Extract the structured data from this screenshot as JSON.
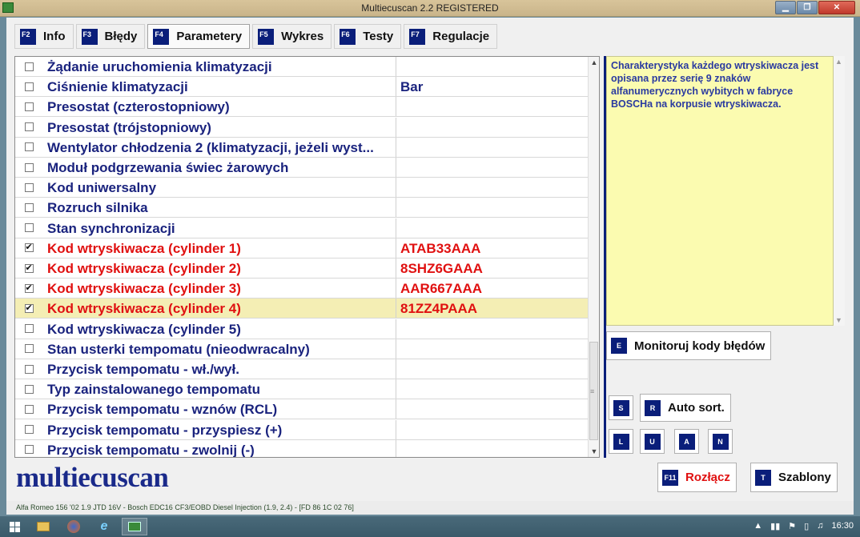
{
  "window": {
    "title": "Multiecuscan 2.2 REGISTERED",
    "buttons": {
      "minimize": "▁",
      "maximize": "❐",
      "close": "✕"
    }
  },
  "tabs": [
    {
      "key": "F2",
      "label": "Info"
    },
    {
      "key": "F3",
      "label": "Błędy"
    },
    {
      "key": "F4",
      "label": "Parametery",
      "active": true
    },
    {
      "key": "F5",
      "label": "Wykres"
    },
    {
      "key": "F6",
      "label": "Testy"
    },
    {
      "key": "F7",
      "label": "Regulacje"
    }
  ],
  "rows": [
    {
      "checked": false,
      "name": "Żądanie uruchomienia klimatyzacji",
      "value": ""
    },
    {
      "checked": false,
      "name": "Ciśnienie klimatyzacji",
      "value": "Bar"
    },
    {
      "checked": false,
      "name": "Presostat (czterostopniowy)",
      "value": ""
    },
    {
      "checked": false,
      "name": "Presostat (trójstopniowy)",
      "value": ""
    },
    {
      "checked": false,
      "name": "Wentylator chłodzenia 2 (klimatyzacji, jeżeli wyst...",
      "value": ""
    },
    {
      "checked": false,
      "name": "Moduł podgrzewania świec żarowych",
      "value": ""
    },
    {
      "checked": false,
      "name": "Kod uniwersalny",
      "value": ""
    },
    {
      "checked": false,
      "name": "Rozruch silnika",
      "value": ""
    },
    {
      "checked": false,
      "name": "Stan synchronizacji",
      "value": ""
    },
    {
      "checked": true,
      "name": "Kod wtryskiwacza (cylinder 1)",
      "value": "ATAB33AAA"
    },
    {
      "checked": true,
      "name": "Kod wtryskiwacza (cylinder 2)",
      "value": "8SHZ6GAAA"
    },
    {
      "checked": true,
      "name": "Kod wtryskiwacza (cylinder 3)",
      "value": "AAR667AAA"
    },
    {
      "checked": true,
      "name": "Kod wtryskiwacza (cylinder 4)",
      "value": "81ZZ4PAAA",
      "selected": true
    },
    {
      "checked": false,
      "name": "Kod wtryskiwacza (cylinder 5)",
      "value": ""
    },
    {
      "checked": false,
      "name": "Stan usterki tempomatu (nieodwracalny)",
      "value": ""
    },
    {
      "checked": false,
      "name": "Przycisk tempomatu - wł./wył.",
      "value": ""
    },
    {
      "checked": false,
      "name": "Typ zainstalowanego tempomatu",
      "value": ""
    },
    {
      "checked": false,
      "name": "Przycisk tempomatu - wznów (RCL)",
      "value": ""
    },
    {
      "checked": false,
      "name": "Przycisk tempomatu - przyspiesz (+)",
      "value": ""
    },
    {
      "checked": false,
      "name": "Przycisk tempomatu - zwolnij (-)",
      "value": ""
    }
  ],
  "info_text": "Charakterystyka każdego wtryskiwacza jest opisana przez serię 9 znaków alfanumerycznych wybitych w fabryce BOSCHa na korpusie wtryskiwacza.",
  "buttons": {
    "monitor": {
      "key": "E",
      "label": "Monitoruj kody błędów"
    },
    "s": {
      "key": "S"
    },
    "auto_sort": {
      "key": "R",
      "label": "Auto sort."
    },
    "l": {
      "key": "L"
    },
    "u": {
      "key": "U"
    },
    "a": {
      "key": "A"
    },
    "n": {
      "key": "N"
    },
    "disconnect": {
      "key": "F11",
      "label": "Rozłącz"
    },
    "templates": {
      "key": "T",
      "label": "Szablony"
    }
  },
  "logo": "multiecuscan",
  "status_text": "Alfa Romeo 156 '02 1.9 JTD 16V - Bosch EDC16 CF3/EOBD Diesel Injection (1.9, 2.4) - [FD 86 1C 02 76]",
  "taskbar": {
    "clock": "16:30"
  },
  "colors": {
    "accent": "#0a1e7a",
    "active_value": "#e01010",
    "param_text": "#1a237e",
    "info_bg": "#fbfbb0",
    "selected_row": "#f4eeb4"
  }
}
